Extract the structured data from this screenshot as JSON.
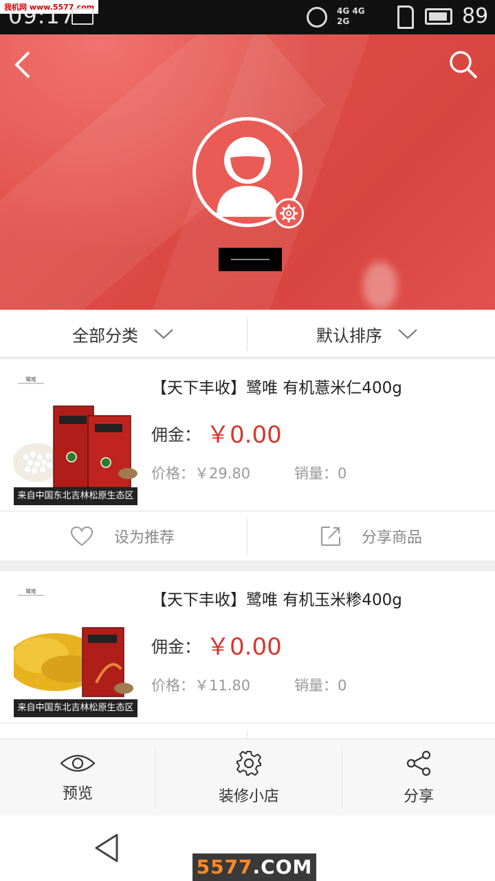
{
  "status_bar": {
    "time": "09:17",
    "watermark": "我机网 www.5577.com",
    "network_top": "4G 4G",
    "network_bottom": "2G",
    "battery_level": "89"
  },
  "header": {
    "back_icon": "chevron-left-icon",
    "search_icon": "search-icon",
    "avatar_icon": "user-avatar-icon",
    "settings_icon": "gear-icon"
  },
  "filters": {
    "category_label": "全部分类",
    "sort_label": "默认排序"
  },
  "products": [
    {
      "title": "【天下丰收】鹭唯 有机薏米仁400g",
      "commission_label": "佣金：",
      "commission_value": "￥0.00",
      "price": "价格：￥29.80",
      "sales": "销量：0",
      "caption": "来自中国东北吉林松原生态区",
      "recommend_label": "设为推荐",
      "share_label": "分享商品"
    },
    {
      "title": "【天下丰收】鹭唯 有机玉米糁400g",
      "commission_label": "佣金：",
      "commission_value": "￥0.00",
      "price": "价格：￥11.80",
      "sales": "销量：0",
      "caption": "来自中国东北吉林松原生态区"
    }
  ],
  "tabbar": {
    "preview_label": "预览",
    "decorate_label": "装修小店",
    "share_label": "分享"
  },
  "watermark_logo": {
    "part1": "5577",
    "part2": ".COM"
  },
  "colors": {
    "brand_red": "#e0504a",
    "price_red": "#d9342c"
  }
}
